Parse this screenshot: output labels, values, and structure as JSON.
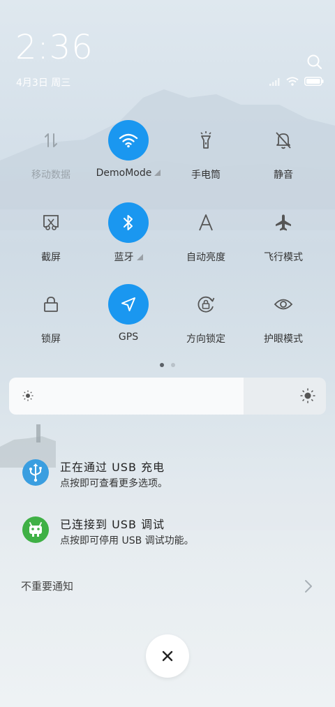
{
  "status_bar": {
    "time": "2:36",
    "date": "4月3日 周三"
  },
  "toggles": [
    {
      "label": "移动数据",
      "icon": "mobile-data-icon",
      "active": false
    },
    {
      "label": "DemoMode",
      "icon": "wifi-icon",
      "active": true,
      "expandable": true
    },
    {
      "label": "手电筒",
      "icon": "flashlight-icon",
      "active": false
    },
    {
      "label": "静音",
      "icon": "mute-bell-icon",
      "active": false
    },
    {
      "label": "截屏",
      "icon": "screenshot-icon",
      "active": false
    },
    {
      "label": "蓝牙",
      "icon": "bluetooth-icon",
      "active": true,
      "expandable": true
    },
    {
      "label": "自动亮度",
      "icon": "auto-brightness-icon",
      "active": false
    },
    {
      "label": "飞行模式",
      "icon": "airplane-icon",
      "active": false
    },
    {
      "label": "锁屏",
      "icon": "lock-icon",
      "active": false
    },
    {
      "label": "GPS",
      "icon": "gps-icon",
      "active": true
    },
    {
      "label": "方向锁定",
      "icon": "rotation-lock-icon",
      "active": false
    },
    {
      "label": "护眼模式",
      "icon": "eye-icon",
      "active": false
    }
  ],
  "pager": {
    "pages": 2,
    "current": 1
  },
  "brightness": {
    "level": 0.74
  },
  "notifications": [
    {
      "title": "正在通过 USB 充电",
      "text": "点按即可查看更多选项。",
      "icon": "usb-icon",
      "color": "#3a9ee0"
    },
    {
      "title": "已连接到 USB 调试",
      "text": "点按即可停用 USB 调试功能。",
      "icon": "android-icon",
      "color": "#3fb045"
    }
  ],
  "minor_notifications": {
    "label": "不重要通知"
  },
  "colors": {
    "accent": "#1a97f0"
  }
}
